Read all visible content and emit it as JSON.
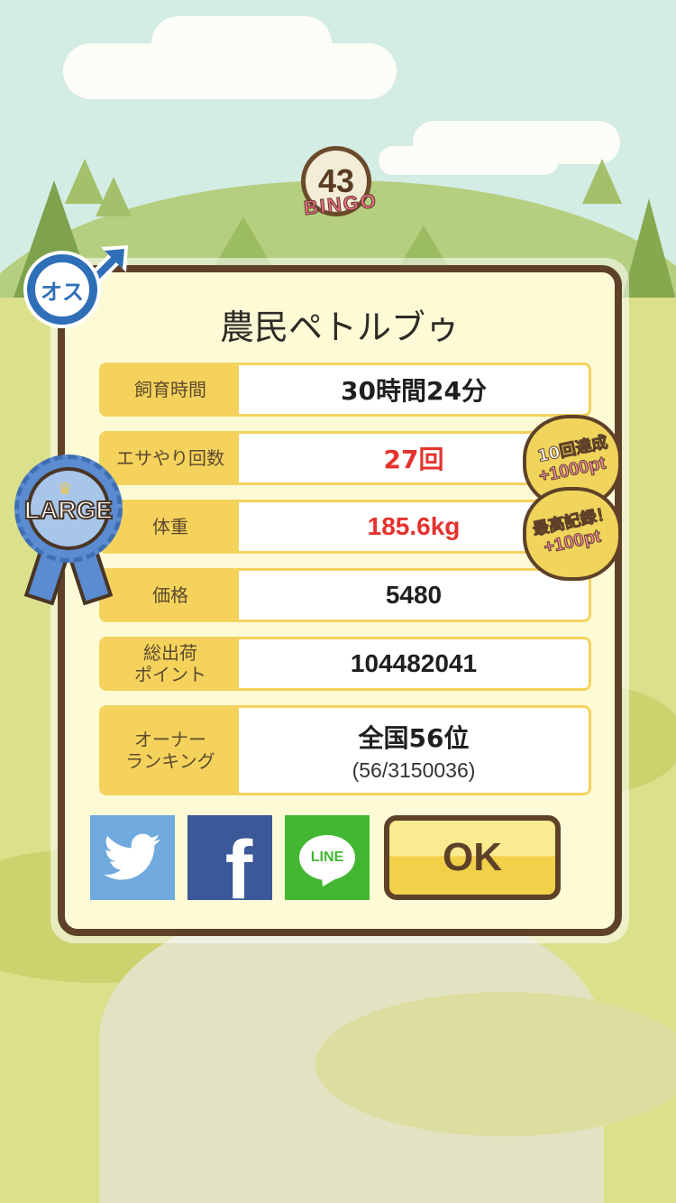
{
  "badge": {
    "number": "43",
    "word": "BINGO"
  },
  "gender": {
    "label": "オス"
  },
  "panel": {
    "title": "農民ペトルブゥ",
    "rows": [
      {
        "label": "飼育時間",
        "value": "30時間24分"
      },
      {
        "label": "エサやり回数",
        "value": "27回"
      },
      {
        "label": "体重",
        "value": "185.6kg"
      },
      {
        "label": "価格",
        "value": "5480"
      },
      {
        "label_line1": "総出荷",
        "label_line2": "ポイント",
        "value": "104482041"
      },
      {
        "label_line1": "オーナー",
        "label_line2": "ランキング",
        "value": "全国56位",
        "sub": "(56/3150036)"
      }
    ]
  },
  "ribbon": {
    "label": "LARGE"
  },
  "stamps": [
    {
      "line1": "10回達成",
      "line2": "+1000pt"
    },
    {
      "line1": "最高記録！",
      "line2": "+100pt"
    }
  ],
  "share": {
    "twitter": "twitter-icon",
    "facebook": "f",
    "line": "LINE"
  },
  "ok_label": "OK",
  "colors": {
    "panel_border": "#5e4128",
    "panel_bg": "#fdfbd6",
    "label_bg": "#f5d25c",
    "highlight_red": "#e5322d",
    "twitter": "#6fa9dd",
    "facebook": "#3b5898",
    "line": "#43b732"
  }
}
